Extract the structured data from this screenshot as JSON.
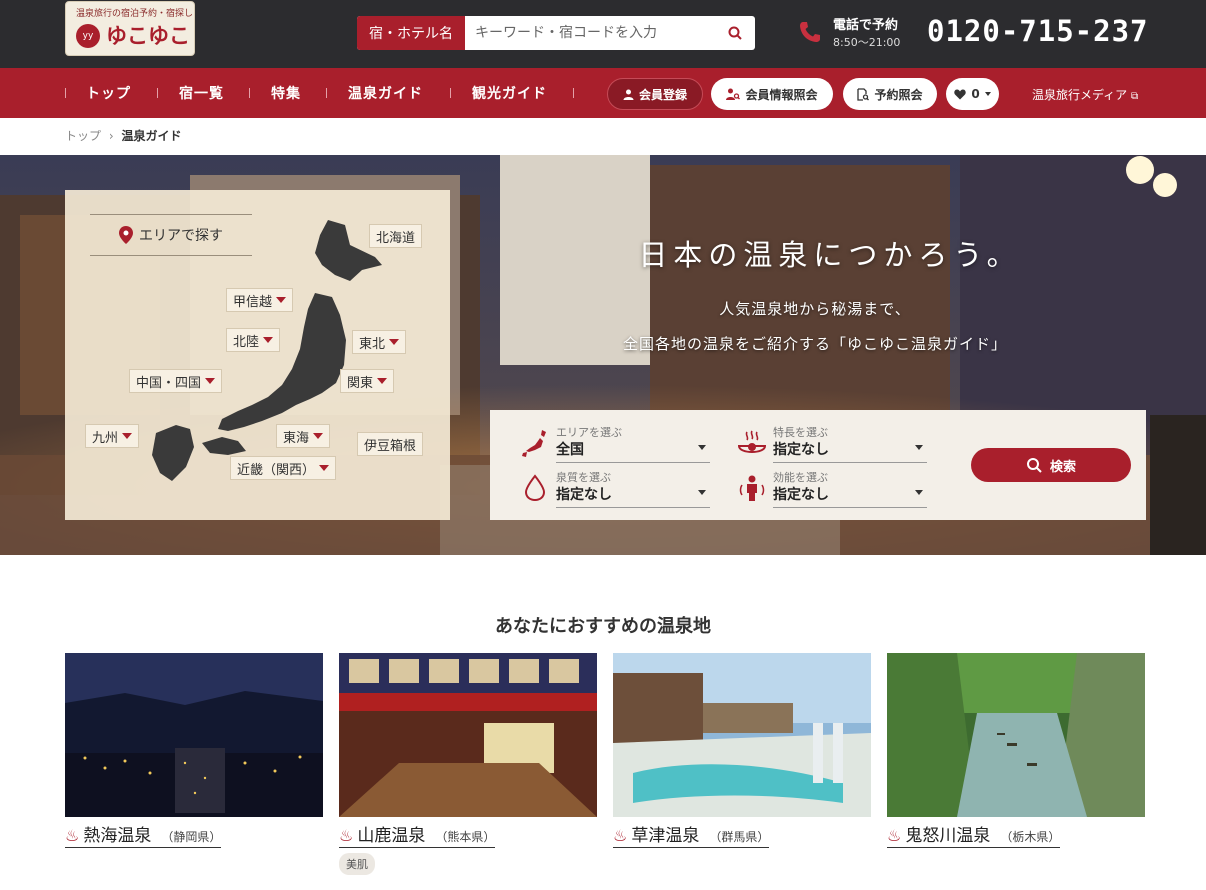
{
  "header": {
    "logo_tagline": "温泉旅行の宿泊予約・宿探し",
    "logo_mark": "yy",
    "logo_name": "ゆこゆこ",
    "search_label": "宿・ホテル名",
    "search_placeholder": "キーワード・宿コードを入力",
    "phone_label": "電話で予約",
    "phone_hours": "8:50〜21:00",
    "phone_number": "0120-715-237"
  },
  "nav": {
    "items": [
      "トップ",
      "宿一覧",
      "特集",
      "温泉ガイド",
      "観光ガイド"
    ],
    "member_register": "会員登録",
    "member_info": "会員情報照会",
    "reservation": "予約照会",
    "favorites_count": "0",
    "media": "温泉旅行メディア"
  },
  "breadcrumb": {
    "home": "トップ",
    "current": "温泉ガイド"
  },
  "hero": {
    "area_title": "エリアで探す",
    "regions": [
      "北海道",
      "甲信越",
      "東北",
      "北陸",
      "関東",
      "中国・四国",
      "九州",
      "東海",
      "伊豆箱根",
      "近畿（関西）"
    ],
    "title": "日本の温泉につかろう。",
    "sub1": "人気温泉地から秘湯まで、",
    "sub2": "全国各地の温泉をご紹介する「ゆこゆこ温泉ガイド」"
  },
  "finder": {
    "area": {
      "label": "エリアを選ぶ",
      "value": "全国"
    },
    "feature": {
      "label": "特長を選ぶ",
      "value": "指定なし"
    },
    "quality": {
      "label": "泉質を選ぶ",
      "value": "指定なし"
    },
    "efficacy": {
      "label": "効能を選ぶ",
      "value": "指定なし"
    },
    "search_label": "検索"
  },
  "recommend": {
    "title": "あなたにおすすめの温泉地",
    "cards": [
      {
        "name": "熱海温泉",
        "pref": "（静岡県）",
        "tag": ""
      },
      {
        "name": "山鹿温泉",
        "pref": "（熊本県）",
        "tag": "美肌"
      },
      {
        "name": "草津温泉",
        "pref": "（群馬県）",
        "tag": ""
      },
      {
        "name": "鬼怒川温泉",
        "pref": "（栃木県）",
        "tag": ""
      }
    ]
  },
  "colors": {
    "brand": "#a91f2c",
    "topbar": "#2c2c2f"
  }
}
